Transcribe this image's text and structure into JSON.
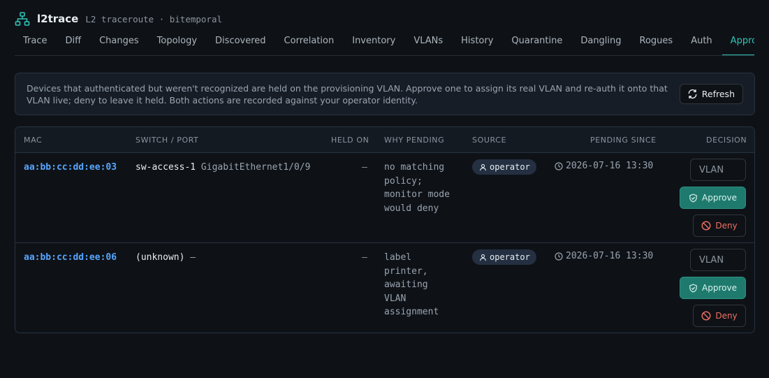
{
  "app": {
    "name": "l2trace",
    "subtitle": "L2 traceroute · bitemporal"
  },
  "tabs": [
    {
      "label": "Trace"
    },
    {
      "label": "Diff"
    },
    {
      "label": "Changes"
    },
    {
      "label": "Topology"
    },
    {
      "label": "Discovered"
    },
    {
      "label": "Correlation"
    },
    {
      "label": "Inventory"
    },
    {
      "label": "VLANs"
    },
    {
      "label": "History"
    },
    {
      "label": "Quarantine"
    },
    {
      "label": "Dangling"
    },
    {
      "label": "Rogues"
    },
    {
      "label": "Auth"
    },
    {
      "label": "Approvals",
      "active": true
    }
  ],
  "info": {
    "text": "Devices that authenticated but weren't recognized are held on the provisioning VLAN. Approve one to assign its real VLAN and re-auth it onto that VLAN live; deny to leave it held. Both actions are recorded against your operator identity.",
    "refresh_label": "Refresh"
  },
  "table": {
    "headers": {
      "mac": "MAC",
      "switch_port": "SWITCH / PORT",
      "held_on": "HELD ON",
      "why_pending": "WHY PENDING",
      "source": "SOURCE",
      "pending_since": "PENDING SINCE",
      "decision": "DECISION"
    },
    "rows": [
      {
        "mac": "aa:bb:cc:dd:ee:03",
        "switch": "sw-access-1",
        "port": "GigabitEthernet1/0/9",
        "held_on": "—",
        "why_lines": [
          "no matching",
          "policy;",
          "monitor mode",
          "would deny"
        ],
        "source": "operator",
        "pending_since": "2026-07-16 13:30",
        "vlan_placeholder": "VLAN",
        "approve_label": "Approve",
        "deny_label": "Deny"
      },
      {
        "mac": "aa:bb:cc:dd:ee:06",
        "switch": "(unknown)",
        "port": "—",
        "held_on": "—",
        "why_lines": [
          "label",
          "printer,",
          "awaiting",
          "VLAN",
          "assignment"
        ],
        "source": "operator",
        "pending_since": "2026-07-16 13:30",
        "vlan_placeholder": "VLAN",
        "approve_label": "Approve",
        "deny_label": "Deny"
      }
    ]
  },
  "colors": {
    "accent": "#2ec4b6",
    "mac_link": "#58a6ff",
    "approve_bg": "#1f7a6e",
    "deny_text": "#f06f62"
  },
  "icons": {
    "logo": "network-tree-icon",
    "refresh": "refresh-icon",
    "source": "user-icon",
    "since": "clock-icon",
    "approve": "shield-check-icon",
    "deny": "ban-icon"
  }
}
